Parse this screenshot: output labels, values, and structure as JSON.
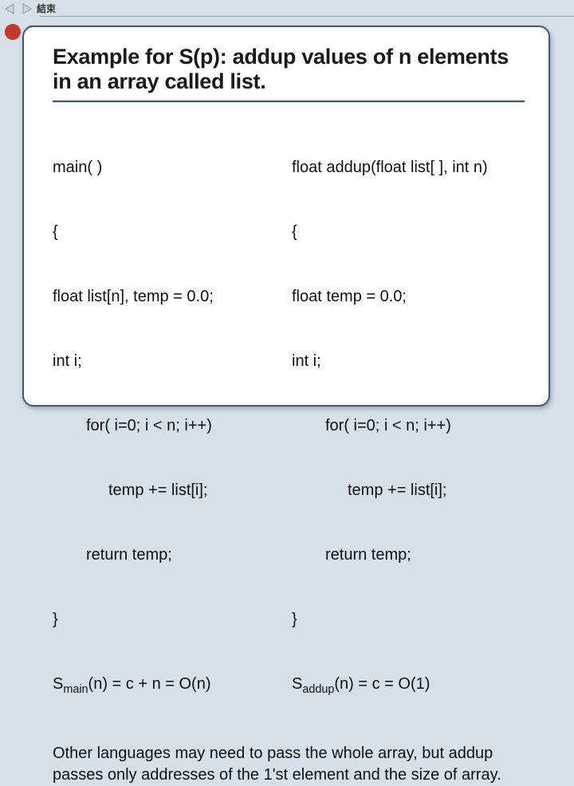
{
  "topbar": {
    "end_label": "結束"
  },
  "slide": {
    "title": "Example for S(p): addup values of n elements in an array called list.",
    "left": {
      "l1": "main( )",
      "l2": "{",
      "l3": "float list[n], temp = 0.0;",
      "l4": "int i;",
      "l5": "for( i=0; i < n; i++)",
      "l6": "temp += list[i];",
      "l7": "return temp;",
      "l8": "}",
      "s_prefix": "S",
      "s_sub": "main",
      "s_rest": "(n) = c + n = O(n)"
    },
    "right": {
      "l1": "float addup(float list[ ], int n)",
      "l2": "{",
      "l3": "float temp = 0.0;",
      "l4": "int i;",
      "l5": "for( i=0; i < n; i++)",
      "l6": "temp += list[i];",
      "l7": "return temp;",
      "l8": "}",
      "s_prefix": "S",
      "s_sub": "addup",
      "s_rest": "(n) = c = O(1)"
    },
    "footer": "Other languages may need to pass the whole array, but addup passes only addresses of the 1'st element and the size of array."
  }
}
